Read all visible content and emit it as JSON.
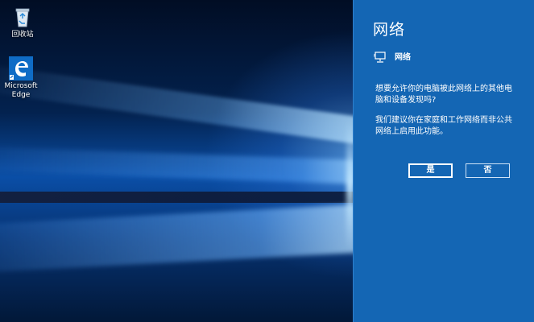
{
  "desktop": {
    "icons": [
      {
        "label": "回收站",
        "icon": "recycle-bin-icon"
      },
      {
        "label": "Microsoft\nEdge",
        "label_line1": "Microsoft",
        "label_line2": "Edge",
        "icon": "edge-icon"
      }
    ]
  },
  "network_panel": {
    "title": "网络",
    "network_name": "网络",
    "network_icon": "network-monitor-icon",
    "question": "想要允许你的电脑被此网络上的其他电脑和设备发现吗?",
    "advice": "我们建议你在家庭和工作网络而非公共网络上启用此功能。",
    "yes_label": "是",
    "no_label": "否",
    "colors": {
      "panel_bg": "#1466b4",
      "text": "#ffffff"
    }
  }
}
